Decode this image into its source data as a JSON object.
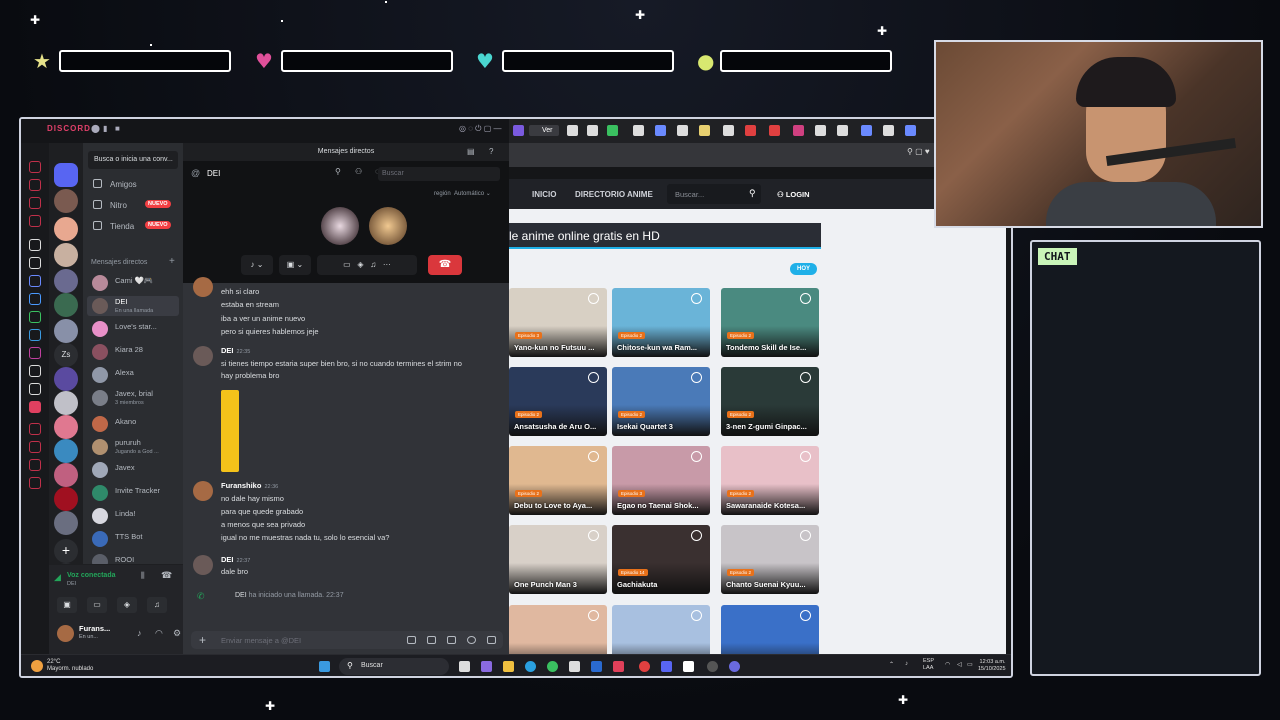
{
  "discord": {
    "app_title": "DISCORD",
    "top_title": "Mensajes directos",
    "search_conv": "Busca o inicia una conv...",
    "nav": [
      {
        "label": "Amigos",
        "badge": ""
      },
      {
        "label": "Nitro",
        "badge": "NUEVO"
      },
      {
        "label": "Tienda",
        "badge": "NUEVO"
      }
    ],
    "dm_header": "Mensajes directos",
    "dm_list": [
      {
        "name": "Cami 🤍🎮",
        "sub": "",
        "color": "#b88a9a"
      },
      {
        "name": "DEI",
        "sub": "En una llamada",
        "color": "#6a5a58"
      },
      {
        "name": "Love's star...",
        "sub": "",
        "color": "#e890c8"
      },
      {
        "name": "Kiara 28",
        "sub": "",
        "color": "#8a5060"
      },
      {
        "name": "Alexa",
        "sub": "",
        "color": "#9098a8"
      },
      {
        "name": "Javex, brial",
        "sub": "3 miembros",
        "color": "#7a7e88"
      },
      {
        "name": "Akano",
        "sub": "",
        "color": "#c06848"
      },
      {
        "name": "pururuh",
        "sub": "Jugando a God ...",
        "color": "#b09070"
      },
      {
        "name": "Javex",
        "sub": "",
        "color": "#a0a8b8"
      },
      {
        "name": "Invite Tracker",
        "sub": "",
        "color": "#2f8a6a"
      },
      {
        "name": "Linda!",
        "sub": "",
        "color": "#d8d8e0"
      },
      {
        "name": "TTS Bot",
        "sub": "",
        "color": "#3a6ab8"
      },
      {
        "name": "ROOI",
        "sub": "",
        "color": "#5a5e68"
      }
    ],
    "voice": {
      "status": "Voz conectada",
      "sub": "DEI"
    },
    "user": {
      "name": "Furans...",
      "status": "En un..."
    },
    "call": {
      "name": "DEI",
      "search_placeholder": "Buscar",
      "region_label": "región",
      "region_value": "Automático"
    },
    "messages": {
      "block1": [
        "ehh si claro",
        "estaba en stream",
        "iba a ver un anime nuevo",
        "pero si quieres hablemos jeje"
      ],
      "msg2": {
        "author": "DEI",
        "time": "22:35",
        "lines": [
          "si tienes tiempo estaria super bien bro, si no cuando termines el strim no",
          "hay problema bro"
        ]
      },
      "msg3": {
        "author": "Furanshiko",
        "time": "22:36",
        "lines": [
          "no dale hay mismo",
          "para que quede grabado",
          "a menos que sea privado",
          "igual no me muestras nada tu, solo lo esencial va?"
        ]
      },
      "msg4": {
        "author": "DEI",
        "time": "22:37",
        "lines": [
          "dale bro"
        ]
      },
      "system": {
        "author": "DEI",
        "text": "ha iniciado una llamada.",
        "time": "22:37"
      }
    },
    "composer_placeholder": "Enviar mensaje a @DEI"
  },
  "browser": {
    "active_tab": "Ver",
    "nav": [
      "INICIO",
      "DIRECTORIO ANIME"
    ],
    "search_placeholder": "Buscar...",
    "login": "LOGIN",
    "banner": "le anime online gratis en HD",
    "hoy": "HOY",
    "cards": [
      {
        "title": "Yano-kun no Futsuu ...",
        "ep": "Episodio 3",
        "color": "#d8d0c4"
      },
      {
        "title": "Chitose-kun wa Ram...",
        "ep": "Episodio 2",
        "color": "#6ab4d8"
      },
      {
        "title": "Tondemo Skill de Ise...",
        "ep": "Episodio 2",
        "color": "#4a8a80"
      },
      {
        "title": "Ansatsusha de Aru O...",
        "ep": "Episodio 2",
        "color": "#2a3a5a"
      },
      {
        "title": "Isekai Quartet 3",
        "ep": "Episodio 2",
        "color": "#4a7ab8"
      },
      {
        "title": "3-nen Z-gumi Ginpac...",
        "ep": "Episodio 2",
        "color": "#2a3a38"
      },
      {
        "title": "Debu to Love to Aya...",
        "ep": "Episodio 2",
        "color": "#e0b890"
      },
      {
        "title": "Egao no Taenai Shok...",
        "ep": "Episodio 3",
        "color": "#c89aa8"
      },
      {
        "title": "Sawaranaide Kotesa...",
        "ep": "Episodio 2",
        "color": "#e8c0c8"
      },
      {
        "title": "One Punch Man 3",
        "ep": "",
        "color": "#d8d0c8"
      },
      {
        "title": "Gachiakuta",
        "ep": "Episodio 14",
        "color": "#3a3030"
      },
      {
        "title": "Chanto Suenai Kyuu...",
        "ep": "Episodio 2",
        "color": "#c8c4c8"
      },
      {
        "title": "",
        "ep": "",
        "color": "#e0b8a0"
      },
      {
        "title": "",
        "ep": "",
        "color": "#a8c0e0"
      },
      {
        "title": "",
        "ep": "",
        "color": "#3a70c8"
      }
    ]
  },
  "taskbar": {
    "weather_temp": "22°C",
    "weather_desc": "Mayorm. nublado",
    "search": "Buscar",
    "lang": "ESP",
    "lang2": "LAA",
    "time": "12:03 a.m.",
    "date": "15/10/2025"
  },
  "overlay": {
    "chat_label": "CHAT"
  }
}
